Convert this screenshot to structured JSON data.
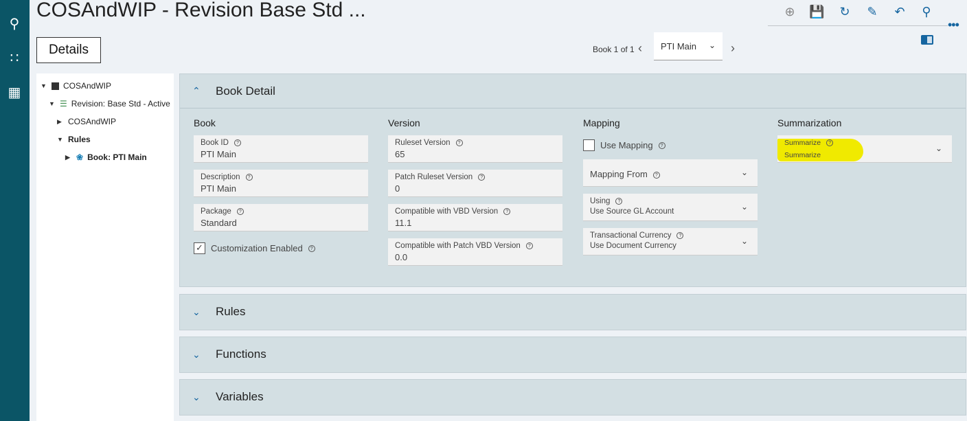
{
  "header": {
    "title": "COSAndWIP - Revision Base Std ...",
    "details_button": "Details",
    "more": "•••"
  },
  "toolbar": {
    "icons": [
      "add-icon",
      "save-icon",
      "refresh-icon",
      "clean-icon",
      "undo-icon",
      "search-icon"
    ]
  },
  "pager": {
    "label": "Book 1 of 1",
    "selected": "PTI Main"
  },
  "tree": [
    {
      "label": "COSAndWIP"
    },
    {
      "label": "Revision: Base Std - Active"
    },
    {
      "label": "COSAndWIP"
    },
    {
      "label": "Rules"
    },
    {
      "label": "Book: PTI Main"
    }
  ],
  "sections": {
    "book_detail": "Book Detail",
    "rules": "Rules",
    "functions": "Functions",
    "variables": "Variables"
  },
  "book": {
    "heading": "Book",
    "fields": [
      {
        "label": "Book ID",
        "value": "PTI Main"
      },
      {
        "label": "Description",
        "value": "PTI Main"
      },
      {
        "label": "Package",
        "value": "Standard"
      }
    ],
    "customization": {
      "label": "Customization Enabled",
      "checked": true
    }
  },
  "version": {
    "heading": "Version",
    "fields": [
      {
        "label": "Ruleset Version",
        "value": "65"
      },
      {
        "label": "Patch Ruleset Version",
        "value": "0"
      },
      {
        "label": "Compatible with VBD Version",
        "value": "11.1"
      },
      {
        "label": "Compatible with Patch VBD Version",
        "value": "0.0"
      }
    ]
  },
  "mapping": {
    "heading": "Mapping",
    "use_mapping": {
      "label": "Use Mapping",
      "checked": false
    },
    "mapping_from": "Mapping From",
    "fields": [
      {
        "label": "Using",
        "value": "Use Source GL Account"
      },
      {
        "label": "Transactional Currency",
        "value": "Use Document Currency"
      }
    ]
  },
  "summarization": {
    "heading": "Summarization",
    "label": "Summarize",
    "value": "Summarize",
    "highlight": "#f0ea00"
  }
}
